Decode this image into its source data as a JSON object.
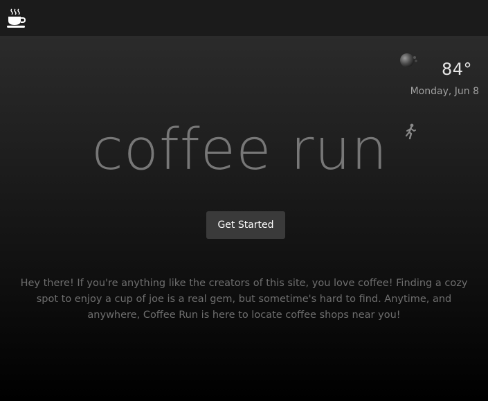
{
  "topbar": {
    "icon": "coffee-cup-icon"
  },
  "weather": {
    "icon": "moon-cloud-icon",
    "temperature": "84°",
    "date": "Monday, Jun 8"
  },
  "hero": {
    "title": "coffee run",
    "title_icon": "running-person-icon",
    "cta_label": "Get Started",
    "description": "Hey there! If you're anything like the creators of this site, you love coffee! Finding a cozy spot to enjoy a cup of joe is a real gem, but sometime's hard to find. Anytime, and anywhere, Coffee Run is here to locate coffee shops near you!"
  },
  "colors": {
    "topbar_bg": "#1b1b1b",
    "button_bg": "#3a3a3a",
    "title_color": "#777777",
    "text_color": "#6e6e6e"
  }
}
